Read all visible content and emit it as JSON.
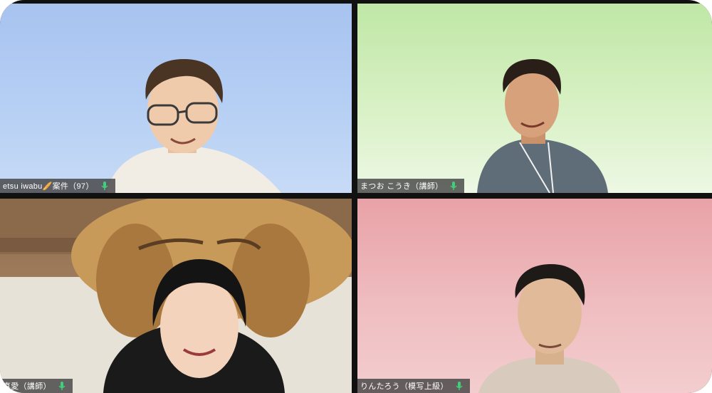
{
  "participants": [
    {
      "name": "etsu iwabu🥖案件（97）",
      "mic": "mic-on-icon"
    },
    {
      "name": "まつお こうき（講師）",
      "mic": "mic-on-icon"
    },
    {
      "name": "真愛（講師）",
      "mic": "mic-on-icon"
    },
    {
      "name": "りんたろう（模写上級）",
      "mic": "mic-on-icon"
    }
  ],
  "colors": {
    "mic_green": "#3fd17a",
    "tile_1_bg": "#a7c3ef",
    "tile_2_bg": "#bfe7a6",
    "tile_4_bg": "#e8a2a7"
  }
}
